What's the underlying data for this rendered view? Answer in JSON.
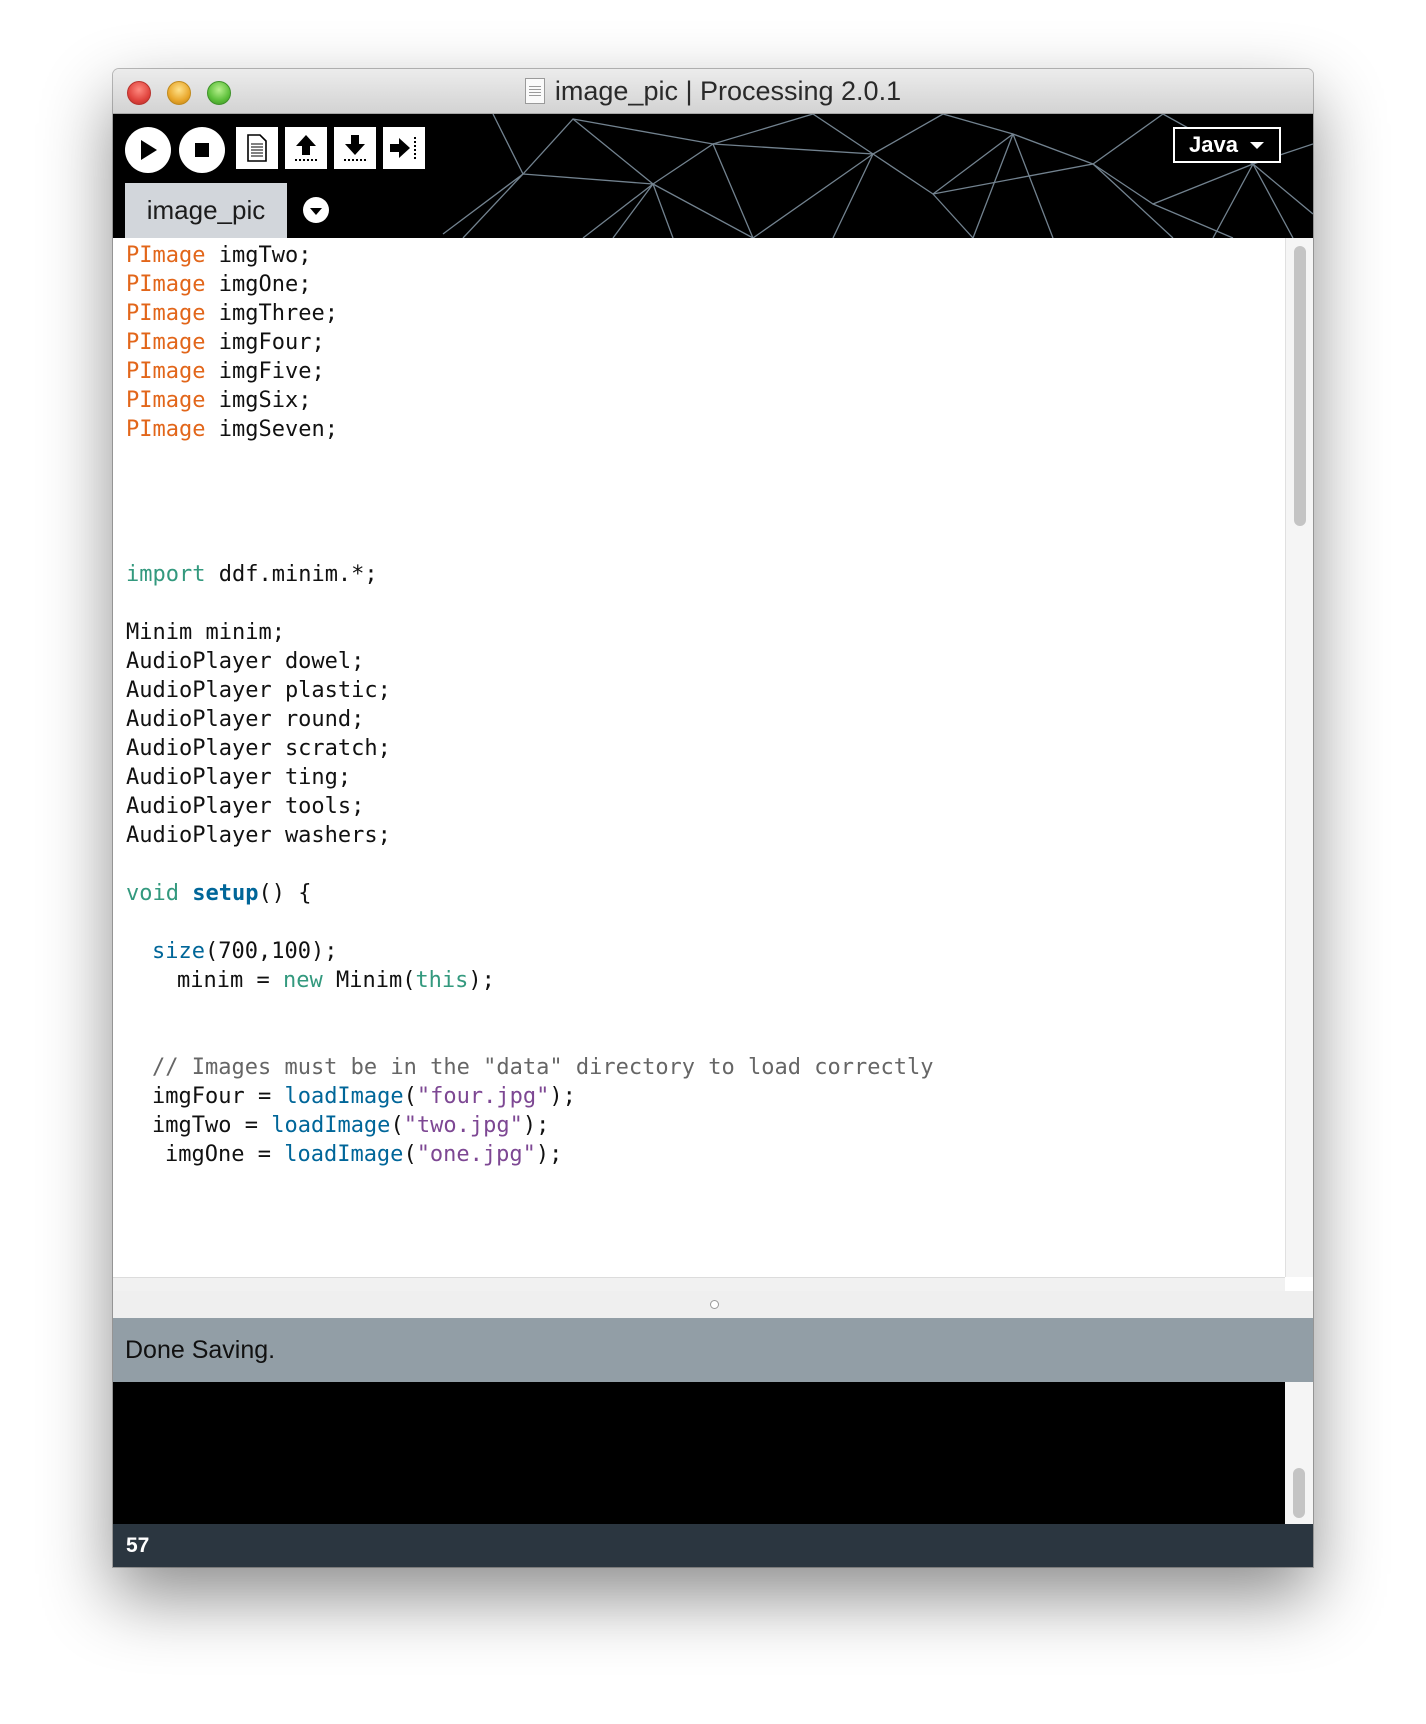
{
  "window": {
    "title": "image_pic | Processing 2.0.1",
    "controls": [
      "close-button",
      "minimize-button",
      "zoom-button"
    ]
  },
  "toolbar": {
    "buttons": [
      "run",
      "stop",
      "new",
      "open",
      "save",
      "export"
    ],
    "mode": "Java"
  },
  "tabs": [
    {
      "label": "image_pic",
      "active": true
    }
  ],
  "editor": {
    "lines": [
      [
        "PImage",
        " imgTwo;"
      ],
      [
        "PImage",
        " imgOne;"
      ],
      [
        "PImage",
        " imgThree;"
      ],
      [
        "PImage",
        " imgFour;"
      ],
      [
        "PImage",
        " imgFive;"
      ],
      [
        "PImage",
        " imgSix;"
      ],
      [
        "PImage",
        " imgSeven;"
      ],
      [
        "import",
        " ddf.minim.*;"
      ],
      "Minim minim;",
      "AudioPlayer dowel;",
      "AudioPlayer plastic;",
      "AudioPlayer round;",
      "AudioPlayer scratch;",
      "AudioPlayer ting;",
      "AudioPlayer tools;",
      "AudioPlayer washers;",
      [
        "void",
        " ",
        "setup",
        "() {"
      ],
      [
        "size",
        "(700,100);"
      ],
      [
        "minim = ",
        "new",
        " Minim(",
        "this",
        ");"
      ],
      "// Images must be in the \"data\" directory to load correctly",
      [
        "imgFour = ",
        "loadImage",
        "(",
        "\"four.jpg\"",
        ");"
      ],
      [
        "imgTwo = ",
        "loadImage",
        "(",
        "\"two.jpg\"",
        ");"
      ],
      [
        "imgOne = ",
        "loadImage",
        "(",
        "\"one.jpg\"",
        ");"
      ]
    ]
  },
  "status": {
    "message": "Done Saving."
  },
  "footer": {
    "line_number": "57"
  },
  "colors": {
    "type_keyword": "#e2661a",
    "import_keyword": "#33997e",
    "function": "#006699",
    "string": "#7d4793",
    "comment": "#666666",
    "status_bar": "#929ea6",
    "footer_bar": "#2b3640"
  }
}
